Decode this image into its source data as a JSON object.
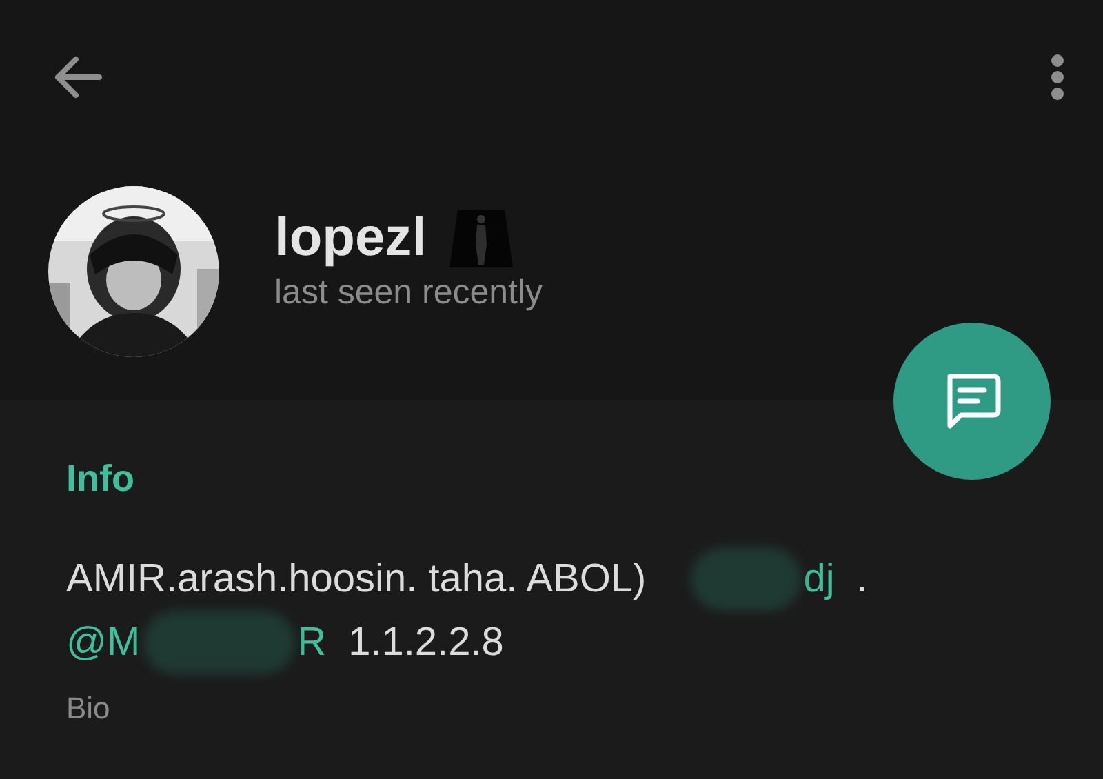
{
  "header": {
    "name": "lopezǀ",
    "status": "last seen recently"
  },
  "info": {
    "title": "Info",
    "bio_lines": [
      [
        {
          "kind": "text",
          "text": "AMIR.arash.hoosin. taha. ABOL)"
        },
        {
          "kind": "redacted"
        },
        {
          "kind": "link",
          "text": "dj"
        },
        {
          "kind": "text",
          "text": "."
        }
      ],
      [
        {
          "kind": "link",
          "text": "@M"
        },
        {
          "kind": "redacted"
        },
        {
          "kind": "link",
          "text": "R"
        },
        {
          "kind": "text",
          "text": "1.1.2.2.8"
        }
      ]
    ],
    "bio_label": "Bio"
  }
}
